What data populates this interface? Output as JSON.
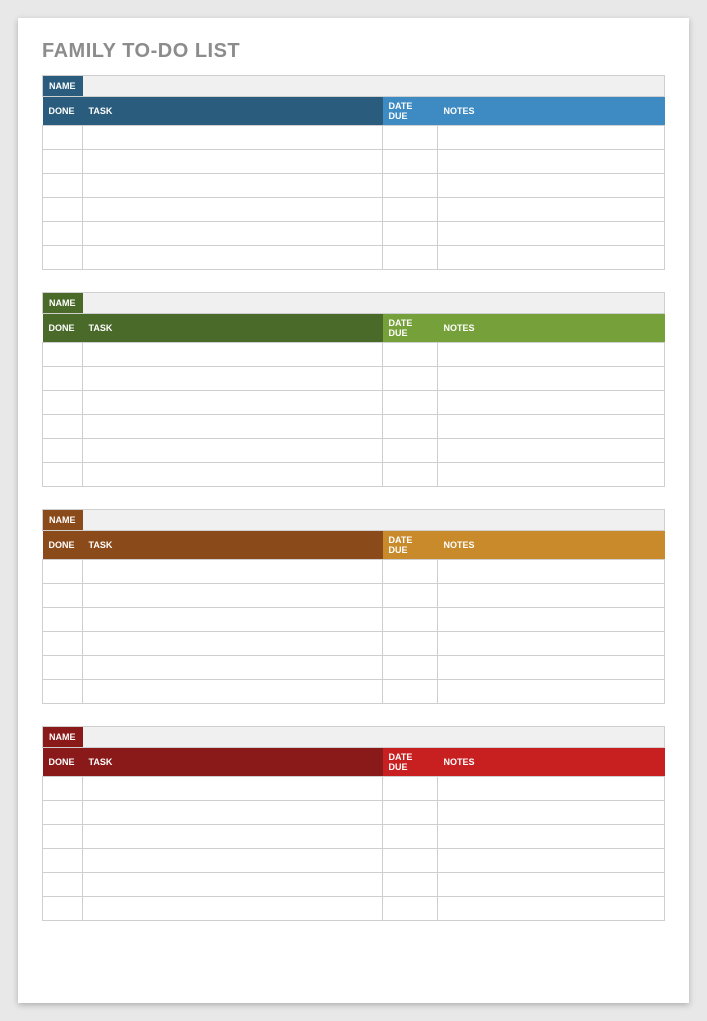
{
  "title": "FAMILY TO-DO LIST",
  "labels": {
    "name": "NAME",
    "done": "DONE",
    "task": "TASK",
    "date_due": "DATE DUE",
    "notes": "NOTES"
  },
  "sections": [
    {
      "id": "section-1",
      "name_bg": "#2a5d7d",
      "header_bg_left": "#2a5d7d",
      "header_bg_right": "#3d8bc2",
      "name_value": "",
      "rows": [
        [
          "",
          "",
          "",
          ""
        ],
        [
          "",
          "",
          "",
          ""
        ],
        [
          "",
          "",
          "",
          ""
        ],
        [
          "",
          "",
          "",
          ""
        ],
        [
          "",
          "",
          "",
          ""
        ],
        [
          "",
          "",
          "",
          ""
        ]
      ]
    },
    {
      "id": "section-2",
      "name_bg": "#4a6a2a",
      "header_bg_left": "#4a6a2a",
      "header_bg_right": "#76a13a",
      "name_value": "",
      "rows": [
        [
          "",
          "",
          "",
          ""
        ],
        [
          "",
          "",
          "",
          ""
        ],
        [
          "",
          "",
          "",
          ""
        ],
        [
          "",
          "",
          "",
          ""
        ],
        [
          "",
          "",
          "",
          ""
        ],
        [
          "",
          "",
          "",
          ""
        ]
      ]
    },
    {
      "id": "section-3",
      "name_bg": "#8a4a1a",
      "header_bg_left": "#8a4a1a",
      "header_bg_right": "#c88a2a",
      "name_value": "",
      "rows": [
        [
          "",
          "",
          "",
          ""
        ],
        [
          "",
          "",
          "",
          ""
        ],
        [
          "",
          "",
          "",
          ""
        ],
        [
          "",
          "",
          "",
          ""
        ],
        [
          "",
          "",
          "",
          ""
        ],
        [
          "",
          "",
          "",
          ""
        ]
      ]
    },
    {
      "id": "section-4",
      "name_bg": "#8a1a1a",
      "header_bg_left": "#8a1a1a",
      "header_bg_right": "#c82020",
      "name_value": "",
      "rows": [
        [
          "",
          "",
          "",
          ""
        ],
        [
          "",
          "",
          "",
          ""
        ],
        [
          "",
          "",
          "",
          ""
        ],
        [
          "",
          "",
          "",
          ""
        ],
        [
          "",
          "",
          "",
          ""
        ],
        [
          "",
          "",
          "",
          ""
        ]
      ]
    }
  ]
}
